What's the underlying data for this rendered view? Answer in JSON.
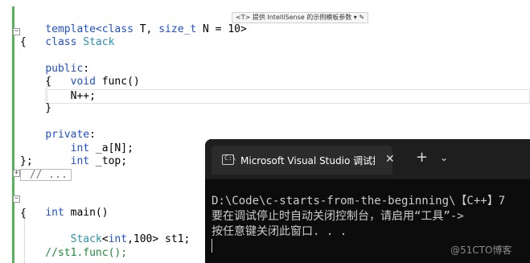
{
  "editor": {
    "hint_chip": "<T> 提供 IntelliSense 的示例模板参数 ▾ ✎",
    "collapsed_text": " // ...",
    "code": {
      "l1_a": "template<",
      "l1_b": "class",
      "l1_c": " T, ",
      "l1_d": "size_t",
      "l1_e": " N = 10>",
      "l2_a": "class",
      "l2_b": " Stack",
      "l3": "{",
      "l4_a": "public",
      "l4_b": ":",
      "l5_a": "    ",
      "l5_b": "void",
      "l5_c": " func()",
      "l6": "    {",
      "l7": "        N++;",
      "l8": "    }",
      "l9_a": "private",
      "l9_b": ":",
      "l10_a": "    ",
      "l10_b": "int",
      "l10_c": " _a[N];",
      "l11_a": "    ",
      "l11_b": "int",
      "l11_c": " _top;",
      "l12": "};",
      "l13_a": "int",
      "l13_b": " main()",
      "l14": "{",
      "l15_a": "    ",
      "l15_b": "Stack",
      "l15_c": "<",
      "l15_d": "int",
      "l15_e": ",100> st1;",
      "l16": "    //st1.func();"
    }
  },
  "terminal": {
    "icon_glyph": "C:\\",
    "tab_title": "Microsoft Visual Studio 调试控制台",
    "close": "✕",
    "plus": "+",
    "dropdown": "⌄",
    "lines": [
      "D:\\Code\\c-starts-from-the-beginning\\【C++】7",
      "要在调试停止时自动关闭控制台，请启用“工具”->",
      "按任意键关闭此窗口. . ."
    ],
    "watermark": "@51CTO博客"
  }
}
